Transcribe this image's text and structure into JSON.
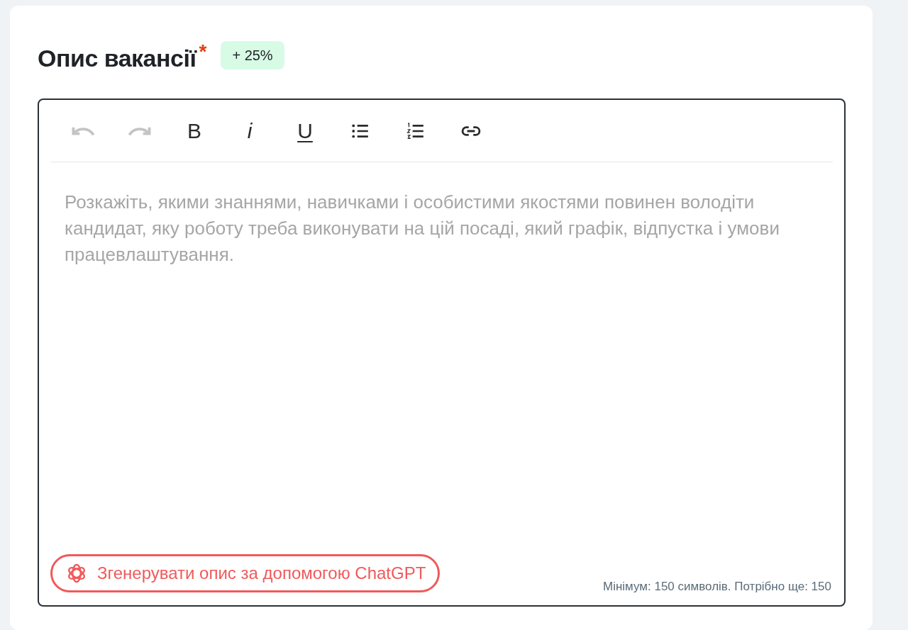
{
  "title": "Опис вакансії",
  "required_mark": "*",
  "bonus_badge": "+ 25%",
  "toolbar": [
    {
      "kind": "undo",
      "disabled": true
    },
    {
      "kind": "redo",
      "disabled": true
    },
    {
      "kind": "bold",
      "label": "B",
      "disabled": false
    },
    {
      "kind": "italic",
      "label": "i",
      "disabled": false
    },
    {
      "kind": "underline",
      "label": "U",
      "disabled": false
    },
    {
      "kind": "bullet_list",
      "disabled": false
    },
    {
      "kind": "numbered_list",
      "disabled": false
    },
    {
      "kind": "link",
      "disabled": false
    }
  ],
  "editor": {
    "placeholder": "Розкажіть, якими знаннями, навичками і особистими якостями повинен володіти кандидат, яку роботу треба виконувати на цій посаді, який графік, відпустка і умови працевлаштування."
  },
  "generate_button": "Згенерувати опис за допомогою ChatGPT",
  "counter": "Мінімум: 150 символів. Потрібно ще: 150"
}
